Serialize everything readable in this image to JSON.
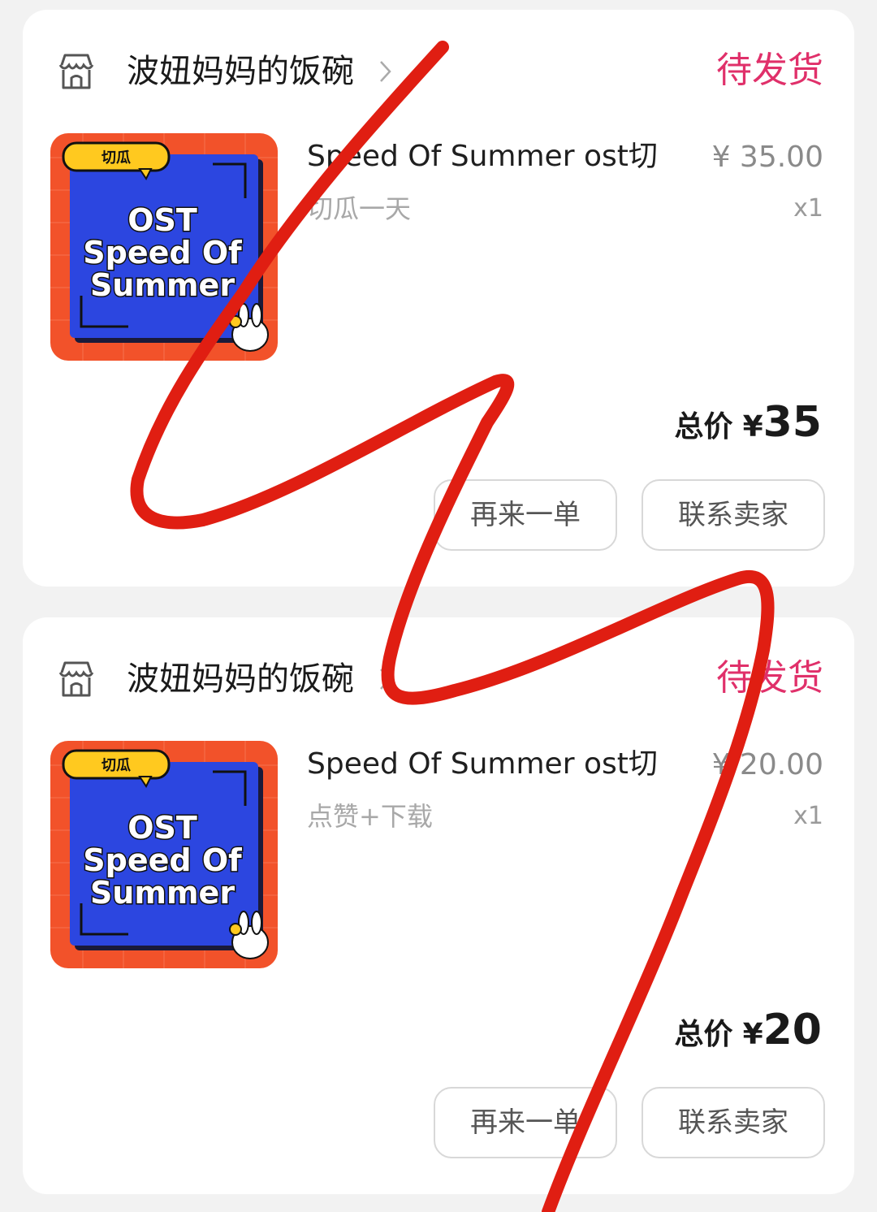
{
  "orders": [
    {
      "shop_name": "波妞妈妈的饭碗",
      "status": "待发货",
      "product": {
        "badge": "切瓜",
        "image_lines": [
          "OST",
          "Speed Of",
          "Summer"
        ],
        "title": "Speed Of Summer ost切",
        "variant": "切瓜一天",
        "unit_price": "¥ 35.00",
        "quantity": "x1"
      },
      "total_label": "总价",
      "currency": "¥",
      "total_amount": "35",
      "buttons": {
        "buy_again": "再来一单",
        "contact_seller": "联系卖家"
      }
    },
    {
      "shop_name": "波妞妈妈的饭碗",
      "status": "待发货",
      "product": {
        "badge": "切瓜",
        "image_lines": [
          "OST",
          "Speed Of",
          "Summer"
        ],
        "title": "Speed Of Summer ost切",
        "variant": "点赞+下载",
        "unit_price": "¥ 20.00",
        "quantity": "x1"
      },
      "total_label": "总价",
      "currency": "¥",
      "total_amount": "20",
      "buttons": {
        "buy_again": "再来一单",
        "contact_seller": "联系卖家"
      }
    }
  ],
  "colors": {
    "status": "#e0306a",
    "thumb_frame": "#f2522a",
    "thumb_panel": "#2c46e0",
    "badge": "#ffc91f",
    "scribble": "#e01e12"
  },
  "icons": {
    "shop": "store-icon",
    "chevron": "chevron-right-icon"
  }
}
